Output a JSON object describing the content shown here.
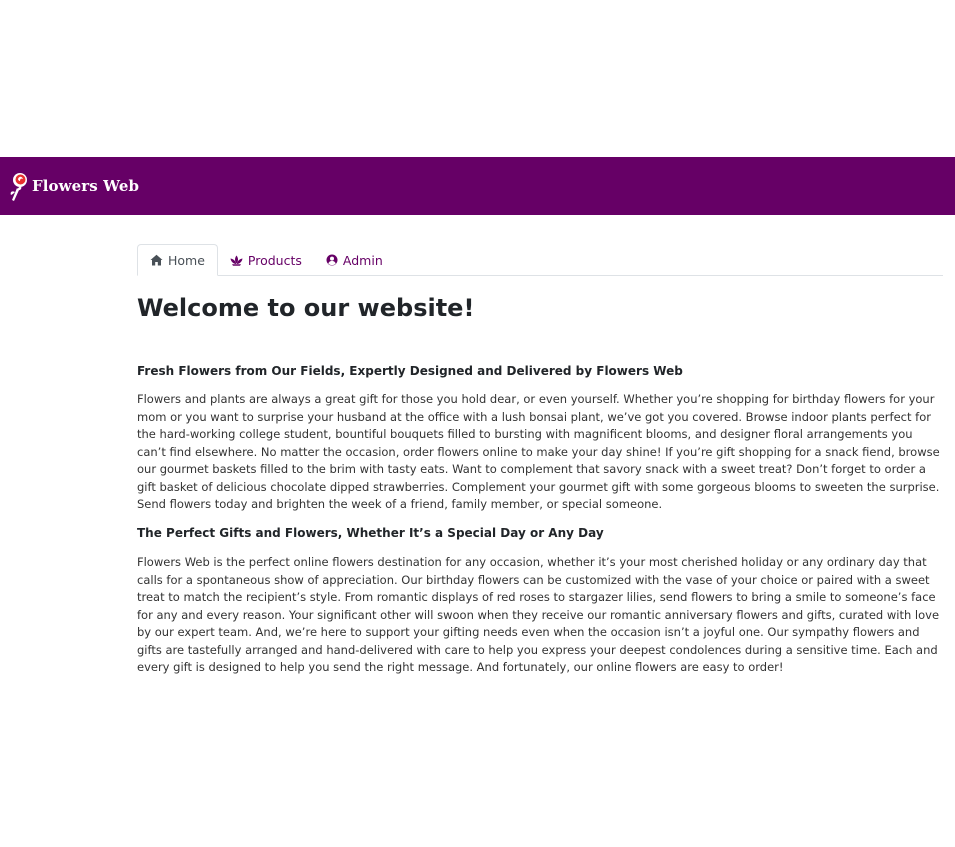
{
  "header": {
    "brand_name": "Flowers Web",
    "background_color": "#660066",
    "logo_icon": "rose-logo-icon"
  },
  "tabs": [
    {
      "label": "Home",
      "icon": "home-icon",
      "active": true
    },
    {
      "label": "Products",
      "icon": "lotus-icon",
      "active": false
    },
    {
      "label": "Admin",
      "icon": "user-circle-icon",
      "active": false
    }
  ],
  "main": {
    "title": "Welcome to our website!",
    "sections": [
      {
        "heading": "Fresh Flowers from Our Fields, Expertly Designed and Delivered by Flowers Web",
        "text": "Flowers and plants are always a great gift for those you hold dear, or even yourself. Whether you’re shopping for birthday flowers for your mom or you want to surprise your husband at the office with a lush bonsai plant, we’ve got you covered. Browse indoor plants perfect for the hard-working college student, bountiful bouquets filled to bursting with magnificent blooms, and designer floral arrangements you can’t find elsewhere. No matter the occasion, order flowers online to make your day shine! If you’re gift shopping for a snack fiend, browse our gourmet baskets filled to the brim with tasty eats. Want to complement that savory snack with a sweet treat? Don’t forget to order a gift basket of delicious chocolate dipped strawberries. Complement your gourmet gift with some gorgeous blooms to sweeten the surprise. Send flowers today and brighten the week of a friend, family member, or special someone."
      },
      {
        "heading": "The Perfect Gifts and Flowers, Whether It’s a Special Day or Any Day",
        "text": "Flowers Web is the perfect online flowers destination for any occasion, whether it’s your most cherished holiday or any ordinary day that calls for a spontaneous show of appreciation. Our birthday flowers can be customized with the vase of your choice or paired with a sweet treat to match the recipient’s style. From romantic displays of red roses to stargazer lilies, send flowers to bring a smile to someone’s face for any and every reason. Your significant other will swoon when they receive our romantic anniversary flowers and gifts, curated with love by our expert team. And, we’re here to support your gifting needs even when the occasion isn’t a joyful one. Our sympathy flowers and gifts are tastefully arranged and hand-delivered with care to help you express your deepest condolences during a sensitive time. Each and every gift is designed to help you send the right message. And fortunately, our online flowers are easy to order!"
      }
    ]
  },
  "colors": {
    "accent": "#660066",
    "text": "#212529",
    "tab_border": "#dee2e6"
  }
}
